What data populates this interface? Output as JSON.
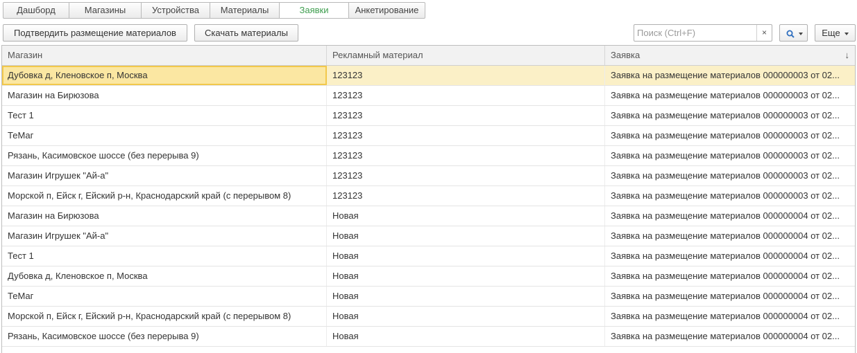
{
  "tabs": [
    {
      "label": "Дашборд",
      "active": false
    },
    {
      "label": "Магазины",
      "active": false
    },
    {
      "label": "Устройства",
      "active": false
    },
    {
      "label": "Материалы",
      "active": false
    },
    {
      "label": "Заявки",
      "active": true
    },
    {
      "label": "Анкетирование",
      "active": false
    }
  ],
  "toolbar": {
    "confirm_label": "Подтвердить размещение материалов",
    "download_label": "Скачать материалы",
    "search_placeholder": "Поиск (Ctrl+F)",
    "search_value": "",
    "clear_glyph": "×",
    "more_label": "Еще"
  },
  "colors": {
    "active_tab": "#3f9e4f",
    "selection": "#fbf0c7",
    "focus_border": "#f2c84b",
    "search_icon": "#2f6fbf"
  },
  "icons": {
    "search_button": "magnifier-icon",
    "dropdown": "chevron-down-icon",
    "clear": "close-icon",
    "sort": "sort-descending-icon"
  },
  "table": {
    "columns": [
      "Магазин",
      "Рекламный материал",
      "Заявка"
    ],
    "sort_glyph": "↓",
    "selected_row": 0,
    "rows": [
      {
        "store": "Дубовка д, Кленовское п, Москва",
        "material": "123123",
        "request": "Заявка на размещение материалов 000000003 от 02..."
      },
      {
        "store": "Магазин на Бирюзова",
        "material": "123123",
        "request": "Заявка на размещение материалов 000000003 от 02..."
      },
      {
        "store": "Тест 1",
        "material": "123123",
        "request": "Заявка на размещение материалов 000000003 от 02..."
      },
      {
        "store": "ТеМаг",
        "material": "123123",
        "request": "Заявка на размещение материалов 000000003 от 02..."
      },
      {
        "store": "Рязань, Касимовское шоссе (без перерыва 9)",
        "material": "123123",
        "request": "Заявка на размещение материалов 000000003 от 02..."
      },
      {
        "store": "Магазин Игрушек \"Ай-а\"",
        "material": "123123",
        "request": "Заявка на размещение материалов 000000003 от 02..."
      },
      {
        "store": "Морской п, Ейск г, Ейский р-н, Краснодарский край (с перерывом 8)",
        "material": "123123",
        "request": "Заявка на размещение материалов 000000003 от 02..."
      },
      {
        "store": "Магазин на Бирюзова",
        "material": "Новая",
        "request": "Заявка на размещение материалов 000000004 от 02..."
      },
      {
        "store": "Магазин Игрушек \"Ай-а\"",
        "material": "Новая",
        "request": "Заявка на размещение материалов 000000004 от 02..."
      },
      {
        "store": "Тест 1",
        "material": "Новая",
        "request": "Заявка на размещение материалов 000000004 от 02..."
      },
      {
        "store": "Дубовка д, Кленовское п, Москва",
        "material": "Новая",
        "request": "Заявка на размещение материалов 000000004 от 02..."
      },
      {
        "store": "ТеМаг",
        "material": "Новая",
        "request": "Заявка на размещение материалов 000000004 от 02..."
      },
      {
        "store": "Морской п, Ейск г, Ейский р-н, Краснодарский край (с перерывом 8)",
        "material": "Новая",
        "request": "Заявка на размещение материалов 000000004 от 02..."
      },
      {
        "store": "Рязань, Касимовское шоссе (без перерыва 9)",
        "material": "Новая",
        "request": "Заявка на размещение материалов 000000004 от 02..."
      }
    ]
  }
}
